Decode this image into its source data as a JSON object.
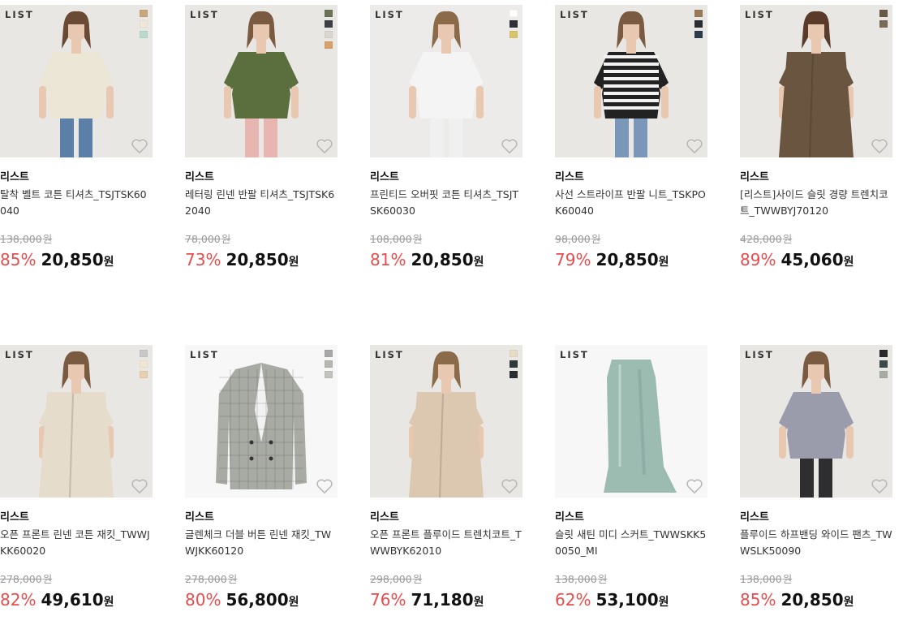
{
  "currency": "원",
  "products": [
    {
      "brand_logo": "LIST",
      "brand": "리스트",
      "name": "탈착 벨트 코튼 티셔츠_TSJTSK60040",
      "original_price": "138,000",
      "discount": "85%",
      "price": "20,850",
      "swatches": [
        "#c8a77e",
        "#efe8da",
        "#bcd9cf"
      ],
      "figure": {
        "top": "#ece6d6",
        "bottom": "#5c7fa8",
        "skin": "#e8c8b0",
        "hair": "#6a4a35"
      },
      "bg": "#e9e7e4"
    },
    {
      "brand_logo": "LIST",
      "brand": "리스트",
      "name": "레터링 린넨 반팔 티셔츠_TSJTSK62040",
      "original_price": "78,000",
      "discount": "73%",
      "price": "20,850",
      "swatches": [
        "#6c7358",
        "#3c4044",
        "#d8d6cf",
        "#d8a06a"
      ],
      "figure": {
        "top": "#5a6e3e",
        "bottom": "#e8b6b0",
        "skin": "#e8c8b0",
        "hair": "#7a5a40"
      },
      "bg": "#e9e7e4"
    },
    {
      "brand_logo": "LIST",
      "brand": "리스트",
      "name": "프린티드 오버핏 코튼 티셔츠_TSJTSK60030",
      "original_price": "108,000",
      "discount": "81%",
      "price": "20,850",
      "swatches": [
        "#ffffff",
        "#2e3033",
        "#d8c46a"
      ],
      "figure": {
        "top": "#f4f4f4",
        "bottom": "#f0f0f0",
        "skin": "#e8c8b0",
        "hair": "#8a6a48"
      },
      "bg": "#ecebe9"
    },
    {
      "brand_logo": "LIST",
      "brand": "리스트",
      "name": "사선 스트라이프 반팔 니트_TSKPOK60040",
      "original_price": "98,000",
      "discount": "79%",
      "price": "20,850",
      "swatches": [
        "#9a7a5a",
        "#2a2e34",
        "#2c3c4c"
      ],
      "figure": {
        "top": "#222222",
        "bottom": "#7a96b8",
        "skin": "#e8c8b0",
        "hair": "#7a5a40"
      },
      "bg": "#e9e7e4"
    },
    {
      "brand_logo": "LIST",
      "brand": "리스트",
      "name": "[리스트]사이드 슬릿 경량 트렌치코트_TWWBYJ70120",
      "original_price": "428,000",
      "discount": "89%",
      "price": "45,060",
      "swatches": [
        "#6a5a48",
        "#7a6a58"
      ],
      "figure": {
        "top": "#6a5640",
        "bottom": "#2a2a2a",
        "skin": "#e8c8b0",
        "hair": "#5a3a28"
      },
      "bg": "#e9e7e4"
    },
    {
      "brand_logo": "LIST",
      "brand": "리스트",
      "name": "오픈 프론트 린넨 코튼 재킷_TWWJKK60020",
      "original_price": "278,000",
      "discount": "82%",
      "price": "49,610",
      "swatches": [
        "#c8c8c8",
        "#f0e6d2",
        "#e8d0b0"
      ],
      "figure": {
        "top": "#e6dccb",
        "bottom": "#e6dccb",
        "skin": "#e8c8b0",
        "hair": "#7a5a40"
      },
      "bg": "#e9e7e4"
    },
    {
      "brand_logo": "LIST",
      "brand": "리스트",
      "name": "글렌체크 더블 버튼 린넨 재킷_TWWJKK60120",
      "original_price": "278,000",
      "discount": "80%",
      "price": "56,800",
      "swatches": [
        "#a8a8a8",
        "#b8b6b0",
        "#c4c2bc"
      ],
      "figure": {
        "top": "#a8aaa4",
        "bottom": "#a8aaa4",
        "skin": "#e8c8b0",
        "hair": "#7a5a40"
      },
      "bg": "#f7f7f7"
    },
    {
      "brand_logo": "LIST",
      "brand": "리스트",
      "name": "오픈 프론트 플루이드 트렌치코트_TWWBYK62010",
      "original_price": "298,000",
      "discount": "76%",
      "price": "71,180",
      "swatches": [
        "#e8dcc6",
        "#2e3a3a",
        "#2a2e32"
      ],
      "figure": {
        "top": "#dcc8b0",
        "bottom": "#6a86a8",
        "skin": "#e8c8b0",
        "hair": "#8a6a48"
      },
      "bg": "#e9e7e4"
    },
    {
      "brand_logo": "LIST",
      "brand": "리스트",
      "name": "슬릿 새틴 미디 스커트_TWWSKK50050_MI",
      "original_price": "138,000",
      "discount": "62%",
      "price": "53,100",
      "swatches": [],
      "figure": {
        "top": "#9cbcb2",
        "bottom": "#9cbcb2",
        "skin": "#e8c8b0",
        "hair": "#7a5a40"
      },
      "bg": "#f7f7f7"
    },
    {
      "brand_logo": "LIST",
      "brand": "리스트",
      "name": "플루이드 하프밴딩 와이드 팬츠_TWWSLK50090",
      "original_price": "138,000",
      "discount": "85%",
      "price": "20,850",
      "swatches": [
        "#2a2a2a",
        "#3c4a4a",
        "#a8aca4"
      ],
      "figure": {
        "top": "#9a9cac",
        "bottom": "#2e2e30",
        "skin": "#e8c8b0",
        "hair": "#7a5a40"
      },
      "bg": "#e9e7e4"
    }
  ]
}
